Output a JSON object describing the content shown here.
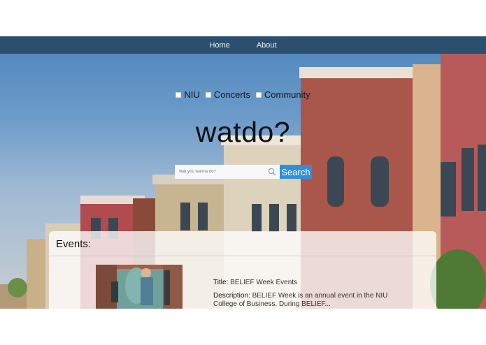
{
  "nav": {
    "home_label": "Home",
    "about_label": "About"
  },
  "filters": [
    {
      "label": "NIU",
      "checked": false
    },
    {
      "label": "Concerts",
      "checked": false
    },
    {
      "label": "Community",
      "checked": false
    }
  ],
  "brand": {
    "title": "watdo?"
  },
  "search": {
    "placeholder": "Wat you wanna do?",
    "value": "",
    "button_label": "Search",
    "icon": "search-icon"
  },
  "events": {
    "heading": "Events:",
    "items": [
      {
        "title_key": "Title:",
        "title": "BELIEF Week Events",
        "description_key": "Description:",
        "description": "BELIEF Week is an annual event in the NIU College of Business. During BELIEF..."
      }
    ]
  },
  "colors": {
    "navbar": "#2c4f6f",
    "search_button": "#2f8fdc",
    "sky": "#4d86bb"
  }
}
